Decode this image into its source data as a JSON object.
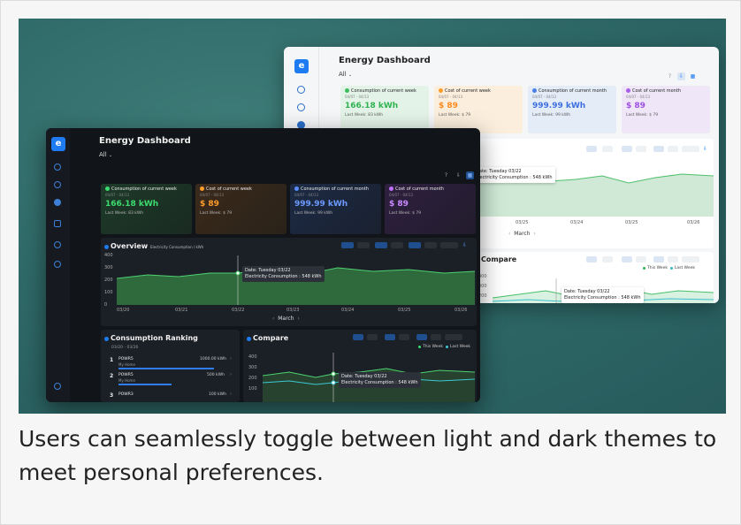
{
  "caption": "Users can seamlessly toggle between light and dark themes to meet personal preferences.",
  "dashboard": {
    "logo_letter": "e",
    "title": "Energy Dashboard",
    "filter": "All",
    "help_icon": "?",
    "kpis": [
      {
        "label": "Consumption of current week",
        "range": "04/07 - 04/13",
        "value": "166.18 kWh",
        "last": "Last Week: 83 kWh"
      },
      {
        "label": "Cost of current week",
        "range": "04/07 - 04/13",
        "value": "$ 89",
        "last": "Last Week: $ 79"
      },
      {
        "label": "Consumption of current month",
        "range": "04/07 - 04/13",
        "value": "999.99 kWh",
        "last": "Last Week: 99 kWh"
      },
      {
        "label": "Cost of current month",
        "range": "04/07 - 04/13",
        "value": "$ 89",
        "last": "Last Week: $ 79"
      }
    ],
    "overview": {
      "title": "Overview",
      "subtitle": "Electricity Consumption / kWh",
      "yticks": [
        "400",
        "300",
        "200",
        "100",
        "0"
      ],
      "xticks": [
        "03/20",
        "03/21",
        "03/22",
        "03/23",
        "03/24",
        "03/25",
        "03/26"
      ],
      "tooltip_date": "Date: Tuesday 03/22",
      "tooltip_value": "Electricity Consumption : 548 kWh",
      "month": "March",
      "prev": "‹",
      "next": "›"
    },
    "ranking": {
      "title": "Consumption Ranking",
      "range": "03/20 - 03/26",
      "items": [
        {
          "rank": "1",
          "name": "POWR5",
          "place": "My Home",
          "value": "1000.00 kWh"
        },
        {
          "rank": "2",
          "name": "POWR5",
          "place": "My Home",
          "value": "500 kWh"
        },
        {
          "rank": "3",
          "name": "POWR3",
          "place": "",
          "value": "100 kWh"
        }
      ]
    },
    "compare": {
      "title": "Compare",
      "legend_this": "This Week",
      "legend_last": "Last Week",
      "yticks": [
        "400",
        "300",
        "200",
        "100"
      ],
      "tooltip_date": "Date: Tuesday 03/22",
      "tooltip_value": "Electricity Consumption : 548 kWh"
    },
    "light_overview_xticks": [
      "03/25",
      "03/24",
      "03/25",
      "03/26"
    ],
    "light_compare_yticks": [
      "400",
      "300",
      "200",
      "100"
    ]
  },
  "colors": {
    "green": "#3ddc6f",
    "orange": "#ff9c2a",
    "blue": "#5a8cff",
    "purple": "#c072ff",
    "accent": "#1f7bf2",
    "teal_bg": "#2f6a68"
  }
}
